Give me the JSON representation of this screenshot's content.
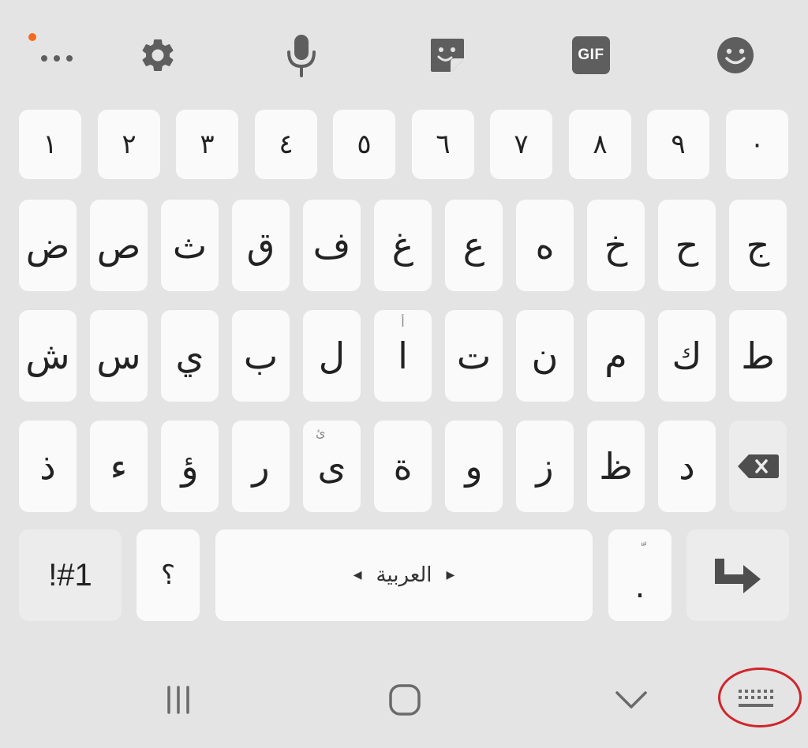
{
  "toolbar": {
    "items": [
      {
        "name": "more-options",
        "icon": "ellipsis-icon",
        "has_notification": true
      },
      {
        "name": "settings",
        "icon": "gear-icon"
      },
      {
        "name": "voice-input",
        "icon": "microphone-icon"
      },
      {
        "name": "stickers",
        "icon": "sticker-icon"
      },
      {
        "name": "gif",
        "icon": "gif-icon",
        "label": "GIF"
      },
      {
        "name": "emoji",
        "icon": "smiley-icon"
      }
    ],
    "gif_label": "GIF",
    "accent_color": "#f46a1f"
  },
  "keyboard": {
    "number_row": [
      "١",
      "٢",
      "٣",
      "٤",
      "٥",
      "٦",
      "٧",
      "٨",
      "٩",
      "٠"
    ],
    "row1": [
      "ض",
      "ص",
      "ث",
      "ق",
      "ف",
      "غ",
      "ع",
      "ه",
      "خ",
      "ح",
      "ج"
    ],
    "row2": [
      "ش",
      "س",
      "ي",
      "ب",
      "ل",
      "ا",
      "ت",
      "ن",
      "م",
      "ك",
      "ط"
    ],
    "row2_hints": {
      "a": "أ"
    },
    "row3": [
      "ذ",
      "ء",
      "ؤ",
      "ر",
      "ى",
      "ة",
      "و",
      "ز",
      "ظ",
      "د"
    ],
    "row3_hints": {
      "ya": "ئ"
    },
    "bottom": {
      "symbols_label": "!#1",
      "question_label": "؟",
      "space_label": "العربية",
      "period_label": ".",
      "period_hint": "ّ"
    },
    "backspace_icon": "backspace-icon",
    "enter_icon": "enter-arrow-icon"
  },
  "navbar": {
    "recents_icon": "recents-icon",
    "home_icon": "home-icon",
    "back_icon": "chevron-down-icon",
    "keyboard_icon": "keyboard-icon",
    "highlight_color": "#d0252b"
  }
}
